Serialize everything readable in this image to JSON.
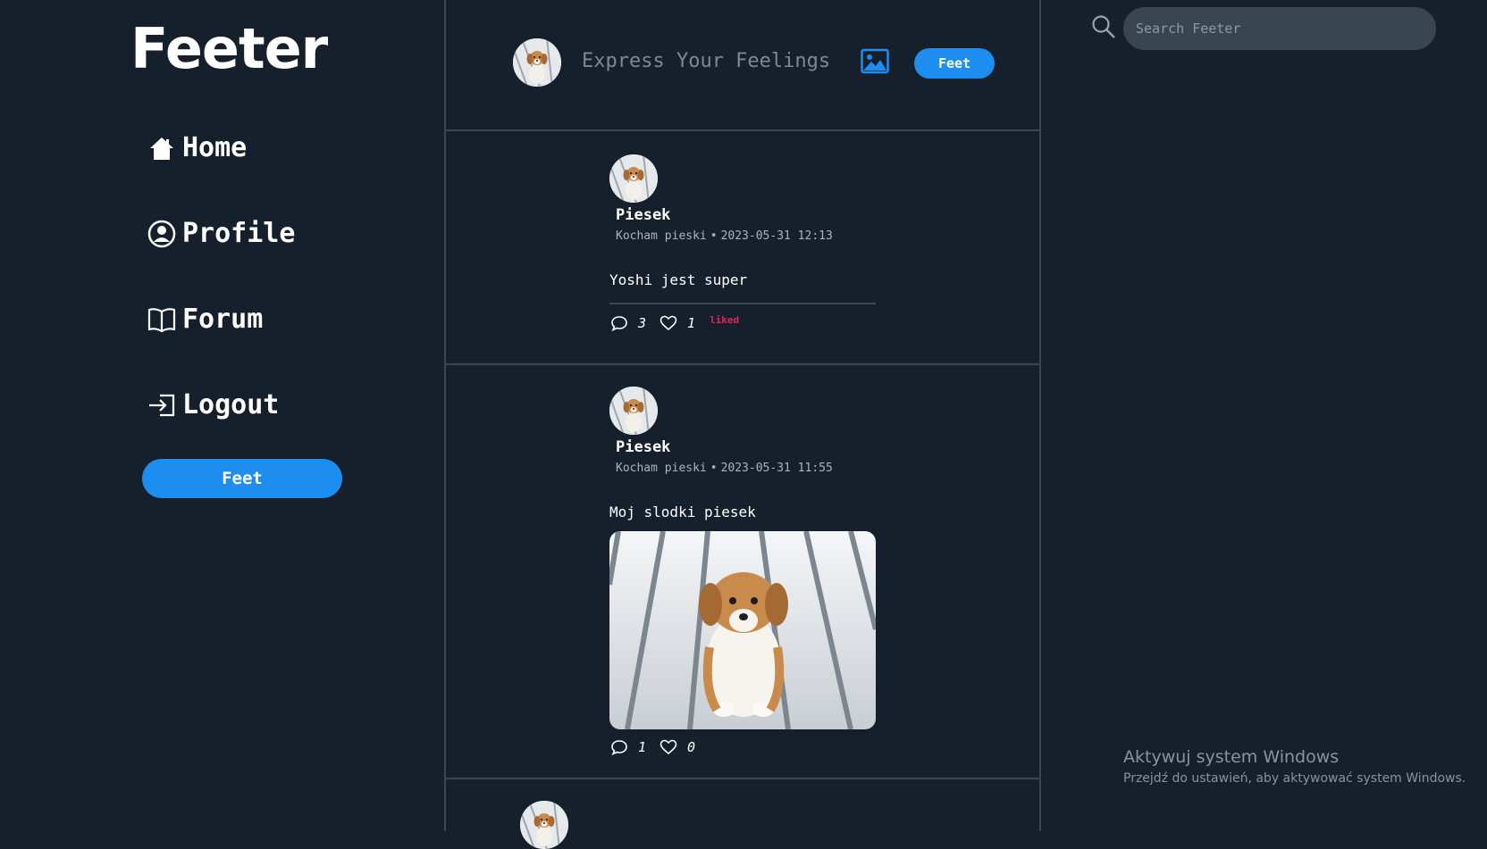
{
  "app": {
    "logo": "Feeter"
  },
  "sidebar": {
    "items": [
      {
        "label": "Home",
        "icon": "home-icon"
      },
      {
        "label": "Profile",
        "icon": "user-circle-icon"
      },
      {
        "label": "Forum",
        "icon": "book-open-icon"
      },
      {
        "label": "Logout",
        "icon": "logout-icon"
      }
    ],
    "feet_button": "Feet"
  },
  "composer": {
    "placeholder": "Express Your Feelings",
    "feet_button": "Feet",
    "image_icon": "image-icon"
  },
  "posts": [
    {
      "author": "Piesek",
      "handle": "Kocham pieski",
      "separator": "•",
      "timestamp": "2023-05-31 12:13",
      "text": "Yoshi jest super",
      "comments": "3",
      "likes": "1",
      "liked_label": "liked"
    },
    {
      "author": "Piesek",
      "handle": "Kocham pieski",
      "separator": "•",
      "timestamp": "2023-05-31 11:55",
      "text": "Moj slodki piesek",
      "comments": "1",
      "likes": "0"
    }
  ],
  "search": {
    "placeholder": "Search Feeter"
  },
  "windows_watermark": {
    "title": "Aktywuj system Windows",
    "subtitle": "Przejdź do ustawień, aby aktywować system Windows."
  },
  "colors": {
    "background": "#16202c",
    "accent": "#1d8ef0",
    "liked": "#e0245e",
    "border": "#3b4654"
  }
}
